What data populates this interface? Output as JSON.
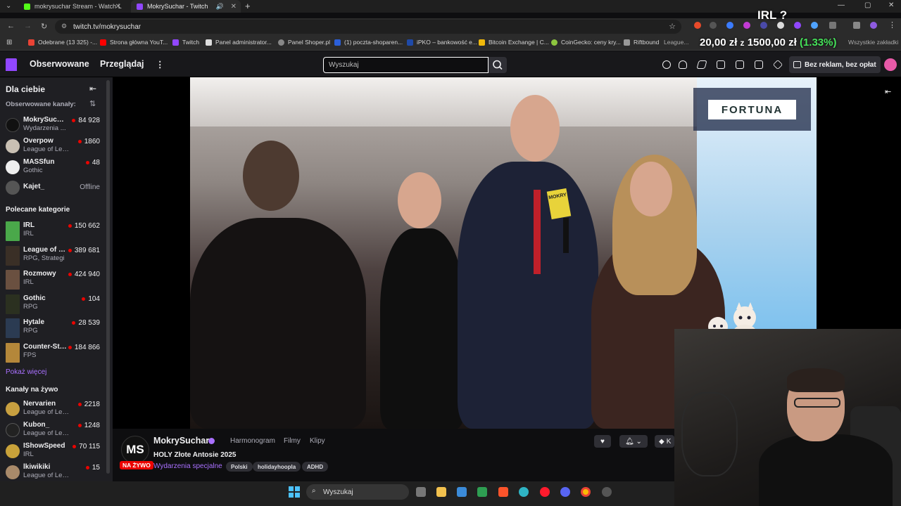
{
  "browser": {
    "tabs": [
      {
        "label": "mokrysuchar Stream - Watch L",
        "active": false
      },
      {
        "label": "MokrySuchar - Twitch",
        "active": true
      }
    ],
    "url": "twitch.tv/mokrysuchar",
    "bookmarks": [
      "Odebrane (13 325) -...",
      "Strona główna YouT...",
      "Twitch",
      "Panel administrator...",
      "Panel Shoper.pl",
      "(1) poczta-shoparen...",
      "iPKO – bankowość e...",
      "Bitcoin Exchange | C...",
      "CoinGecko: ceny kry...",
      "Riftbound",
      "League..."
    ],
    "all_bookmarks": "Wszystkie zakładki"
  },
  "overlay": {
    "irl_label": "IRL ?",
    "price_a": "20,00 zł",
    "price_sep": "z",
    "price_b": "1500,00 zł",
    "price_change": "(1.33%)"
  },
  "nav": {
    "following": "Obserwowane",
    "browse": "Przeglądaj",
    "search_placeholder": "Wyszukaj",
    "noads": "Bez reklam, bez opłat"
  },
  "sidebar": {
    "title": "Dla ciebie",
    "followed_label": "Obserwowane kanały:",
    "followed": [
      {
        "name": "MokrySuchar",
        "game": "Wydarzenia ...",
        "count": "84 928"
      },
      {
        "name": "Overpow",
        "game": "League of Leg...",
        "count": "1860"
      },
      {
        "name": "MASSfun",
        "game": "Gothic",
        "count": "48"
      },
      {
        "name": "Kajet_",
        "game": "",
        "count": "Offline"
      }
    ],
    "categories_label": "Polecane kategorie",
    "categories": [
      {
        "name": "IRL",
        "sub": "IRL",
        "count": "150 662",
        "color": "#4aa84a"
      },
      {
        "name": "League of L...",
        "sub": "RPG, Strategi",
        "count": "389 681",
        "color": "#3a2f26"
      },
      {
        "name": "Rozmowy",
        "sub": "IRL",
        "count": "424 940",
        "color": "#6a5040"
      },
      {
        "name": "Gothic",
        "sub": "RPG",
        "count": "104",
        "color": "#2b3020"
      },
      {
        "name": "Hytale",
        "sub": "RPG",
        "count": "28 539",
        "color": "#2b3b52"
      },
      {
        "name": "Counter-Str...",
        "sub": "FPS",
        "count": "184 866",
        "color": "#b4873a"
      }
    ],
    "show_more": "Pokaż więcej",
    "live_label": "Kanały na żywo",
    "live": [
      {
        "name": "Nervarien",
        "game": "League of Leg...",
        "count": "2218"
      },
      {
        "name": "Kubon_",
        "game": "League of Leg...",
        "count": "1248"
      },
      {
        "name": "IShowSpeed",
        "game": "IRL",
        "count": "70 115"
      },
      {
        "name": "lkiwikiki",
        "game": "League of Lege...",
        "count": "15"
      }
    ]
  },
  "video": {
    "sponsor": "FORTUNA",
    "mic_label": "MOKRY"
  },
  "channel": {
    "logo": "MS",
    "live_badge": "NA ŻYWO",
    "name": "MokrySuchar",
    "tabs": [
      "Harmonogram",
      "Filmy",
      "Klipy"
    ],
    "title": "HOLY Złote Antosie 2025",
    "category": "Wydarzenia specjalne",
    "tags": [
      "Polski",
      "holidayhoopla",
      "ADHD"
    ],
    "sub_btn": "K"
  },
  "taskbar": {
    "search": "Wyszukaj"
  },
  "colors": {
    "twitch_purple": "#9147ff",
    "live_red": "#eb0400",
    "price_green": "#46e35a"
  }
}
